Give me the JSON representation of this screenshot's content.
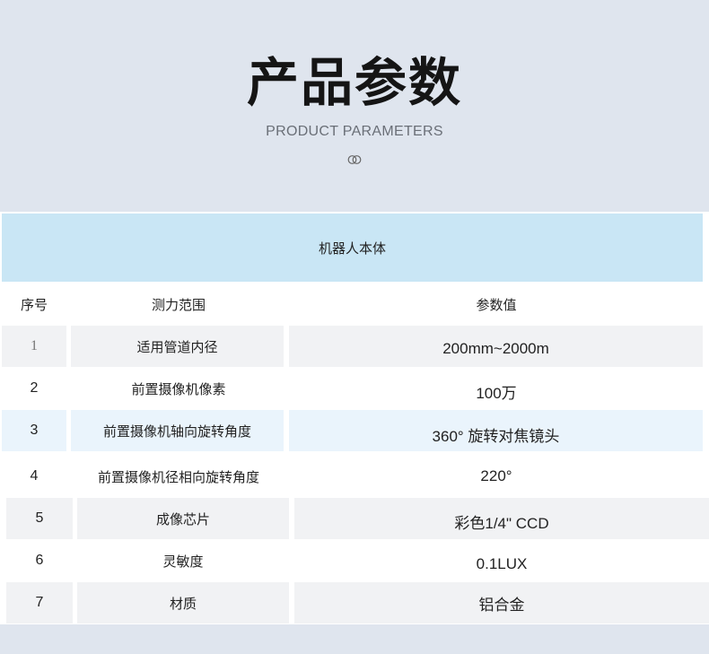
{
  "header": {
    "title": "产品参数",
    "subtitle": "PRODUCT PARAMETERS",
    "decoration_icon": "interlocking-rings-icon"
  },
  "table": {
    "section_title": "机器人本体",
    "columns": [
      "序号",
      "测力范围",
      "参数值"
    ],
    "rows": [
      {
        "no": "1",
        "item": "适用管道内径",
        "value": "200mm~2000m"
      },
      {
        "no": "2",
        "item": "前置摄像机像素",
        "value": "100万"
      },
      {
        "no": "3",
        "item": "前置摄像机轴向旋转角度",
        "value": "360° 旋转对焦镜头"
      },
      {
        "no": "4",
        "item": "前置摄像机径相向旋转角度",
        "value": "220°"
      },
      {
        "no": "5",
        "item": "成像芯片",
        "value": "彩色1/4\" CCD"
      },
      {
        "no": "6",
        "item": "灵敏度",
        "value": "0.1LUX"
      },
      {
        "no": "7",
        "item": "材质",
        "value": "铝合金"
      }
    ]
  },
  "colors": {
    "page_bg": "#dfe5ee",
    "section_head_bg": "#c9e6f5",
    "row_shade": "#f1f2f4",
    "row_highlight": "#eaf4fc",
    "title_text": "#151515",
    "subtitle_text": "#6a6f77"
  }
}
